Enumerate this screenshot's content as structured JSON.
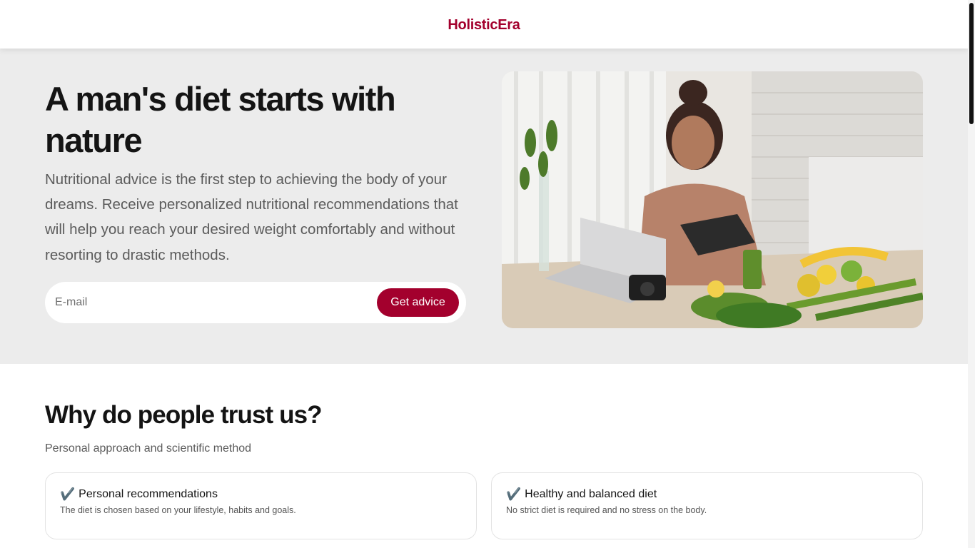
{
  "header": {
    "logo": "HolisticEra"
  },
  "hero": {
    "title": "A man's diet starts with nature",
    "description": "Nutritional advice is the first step to achieving the body of your dreams. Receive personalized nutritional recommendations that will help you reach your desired weight comfortably and without resorting to drastic methods.",
    "email_placeholder": "E-mail",
    "email_value": "",
    "button_label": "Get advice",
    "image_icon": "woman-with-tablet-and-vegetables-photo"
  },
  "trust": {
    "title": "Why do people trust us?",
    "subtitle": "Personal approach and scientific method",
    "cards": [
      {
        "icon": "check-icon",
        "check": "✔️",
        "title": "Personal recommendations",
        "text": "The diet is chosen based on your lifestyle, habits and goals."
      },
      {
        "icon": "check-icon",
        "check": "✔️",
        "title": "Healthy and balanced diet",
        "text": "No strict diet is required and no stress on the body."
      }
    ]
  },
  "colors": {
    "accent": "#a3002d",
    "hero_bg": "#ececec",
    "text": "#141414",
    "muted": "#5b5b5b"
  }
}
